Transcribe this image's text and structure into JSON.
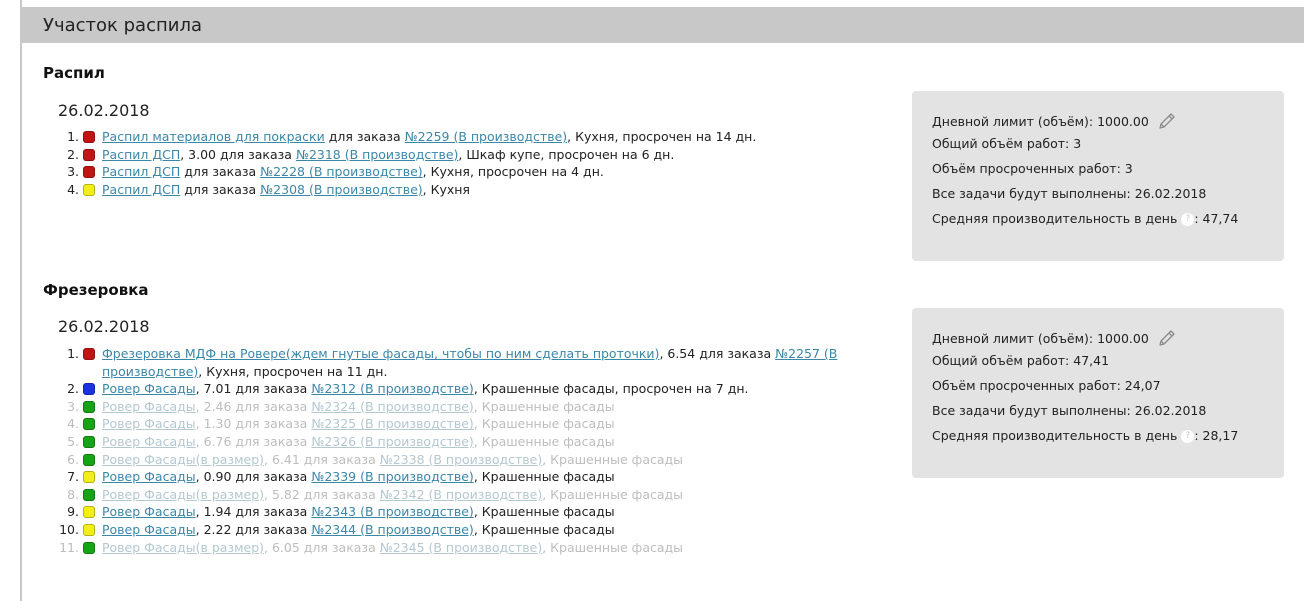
{
  "page": {
    "title": "Участок распила"
  },
  "sections": [
    {
      "title": "Распил",
      "date": "26.02.2018",
      "tasks": [
        {
          "num": "1.",
          "status_color": "#c01515",
          "muted": false,
          "task": "Распил материалов для покраски",
          "volume": "",
          "for_order": "для заказа",
          "order": "№2259 (В производстве)",
          "rest": ", Кухня, просрочен на 14 дн."
        },
        {
          "num": "2.",
          "status_color": "#c01515",
          "muted": false,
          "task": "Распил ДСП",
          "volume": ", 3.00",
          "for_order": "для заказа",
          "order": "№2318 (В производстве)",
          "rest": ", Шкаф купе, просрочен на 6 дн."
        },
        {
          "num": "3.",
          "status_color": "#c01515",
          "muted": false,
          "task": "Распил ДСП",
          "volume": "",
          "for_order": "для заказа",
          "order": "№2228 (В производстве)",
          "rest": ", Кухня, просрочен на 4 дн."
        },
        {
          "num": "4.",
          "status_color": "#f2ee1a",
          "muted": false,
          "task": "Распил ДСП",
          "volume": "",
          "for_order": "для заказа",
          "order": "№2308 (В производстве)",
          "rest": ", Кухня"
        }
      ],
      "stats": {
        "daily_limit_label": "Дневной лимит (объём): 1000.00",
        "total_label": "Общий объём работ: 3",
        "overdue_label": "Объём просроченных работ: 3",
        "complete_label": "Все задачи будут выполнены: 26.02.2018",
        "avg_label": "Средняя производительность в день",
        "avg_value": ": 47,74"
      }
    },
    {
      "title": "Фрезеровка",
      "date": "26.02.2018",
      "tasks": [
        {
          "num": "1.",
          "status_color": "#c01515",
          "muted": false,
          "task": "Фрезеровка МДФ на Ровере(ждем гнутые фасады, чтобы по ним сделать проточки)",
          "volume": ", 6.54",
          "for_order": "для заказа",
          "order": "№2257 (В производстве)",
          "rest": ", Кухня, просрочен на 11 дн."
        },
        {
          "num": "2.",
          "status_color": "#1a33e0",
          "muted": false,
          "task": "Ровер Фасады",
          "volume": ", 7.01",
          "for_order": "для заказа",
          "order": "№2312 (В производстве)",
          "rest": ", Крашенные фасады, просрочен на 7 дн."
        },
        {
          "num": "3.",
          "status_color": "#17a317",
          "muted": true,
          "task": "Ровер Фасады",
          "volume": ", 2.46",
          "for_order": "для заказа",
          "order": "№2324 (В производстве)",
          "rest": ", Крашенные фасады"
        },
        {
          "num": "4.",
          "status_color": "#17a317",
          "muted": true,
          "task": "Ровер Фасады",
          "volume": ", 1.30",
          "for_order": "для заказа",
          "order": "№2325 (В производстве)",
          "rest": ", Крашенные фасады"
        },
        {
          "num": "5.",
          "status_color": "#17a317",
          "muted": true,
          "task": "Ровер Фасады",
          "volume": ", 6.76",
          "for_order": "для заказа",
          "order": "№2326 (В производстве)",
          "rest": ", Крашенные фасады"
        },
        {
          "num": "6.",
          "status_color": "#17a317",
          "muted": true,
          "task": "Ровер Фасады(в размер)",
          "volume": ", 6.41",
          "for_order": "для заказа",
          "order": "№2338 (В производстве)",
          "rest": ", Крашенные фасады"
        },
        {
          "num": "7.",
          "status_color": "#f2ee1a",
          "muted": false,
          "task": "Ровер Фасады",
          "volume": ", 0.90",
          "for_order": "для заказа",
          "order": "№2339 (В производстве)",
          "rest": ", Крашенные фасады"
        },
        {
          "num": "8.",
          "status_color": "#17a317",
          "muted": true,
          "task": "Ровер Фасады(в размер)",
          "volume": ", 5.82",
          "for_order": "для заказа",
          "order": "№2342 (В производстве)",
          "rest": ", Крашенные фасады"
        },
        {
          "num": "9.",
          "status_color": "#f2ee1a",
          "muted": false,
          "task": "Ровер Фасады",
          "volume": ", 1.94",
          "for_order": "для заказа",
          "order": "№2343 (В производстве)",
          "rest": ", Крашенные фасады"
        },
        {
          "num": "10.",
          "status_color": "#f2ee1a",
          "muted": false,
          "task": "Ровер Фасады",
          "volume": ", 2.22",
          "for_order": "для заказа",
          "order": "№2344 (В производстве)",
          "rest": ", Крашенные фасады"
        },
        {
          "num": "11.",
          "status_color": "#17a317",
          "muted": true,
          "task": "Ровер Фасады(в размер)",
          "volume": ", 6.05",
          "for_order": "для заказа",
          "order": "№2345 (В производстве)",
          "rest": ", Крашенные фасады"
        }
      ],
      "stats": {
        "daily_limit_label": "Дневной лимит (объём): 1000.00",
        "total_label": "Общий объём работ: 47,41",
        "overdue_label": "Объём просроченных работ: 24,07",
        "complete_label": "Все задачи будут выполнены: 26.02.2018",
        "avg_label": "Средняя производительность в день",
        "avg_value": ": 28,17"
      }
    }
  ],
  "icons": {
    "edit": "pencil-icon",
    "help": "question-circle-icon"
  }
}
